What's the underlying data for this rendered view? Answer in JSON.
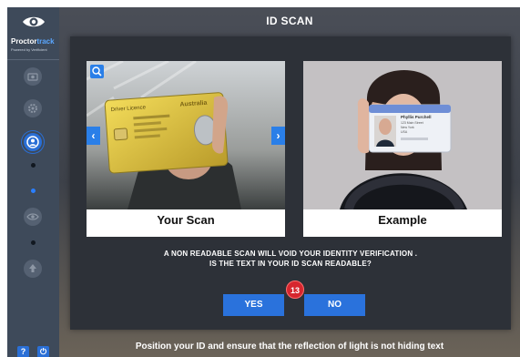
{
  "brand": {
    "name_main": "Proctor",
    "name_accent": "track",
    "tagline": "Powered by Verificient"
  },
  "sidebar": {
    "steps": [
      {
        "icon": "camera-icon"
      },
      {
        "icon": "gear-icon"
      },
      {
        "icon": "id-badge-icon",
        "active": true
      },
      {
        "icon": "eye-icon"
      },
      {
        "icon": "upload-icon"
      }
    ],
    "footer": {
      "help_label": "?",
      "power_label": "⏻"
    }
  },
  "header": {
    "title": "ID SCAN"
  },
  "cards": {
    "scan": {
      "caption": "Your Scan",
      "prev_label": "‹",
      "next_label": "›"
    },
    "example": {
      "caption": "Example"
    }
  },
  "scan_card_text": {
    "license_title": "Driver Licence",
    "state": "Australia"
  },
  "example_card_text": {
    "name": "Phyllis Purchell",
    "line2": "123 Main Street",
    "line3": "New York",
    "line4": "USA"
  },
  "question": {
    "line1": "A NON READABLE SCAN WILL VOID YOUR IDENTITY VERIFICATION .",
    "line2": "IS THE TEXT IN YOUR ID SCAN READABLE?"
  },
  "actions": {
    "yes_label": "YES",
    "no_label": "NO",
    "badge_count": "13"
  },
  "footer": {
    "hint": "Position your ID and ensure that the reflection of light is not hiding text"
  },
  "colors": {
    "accent": "#2a72dc",
    "badge": "#d6262e",
    "sidebar": "#3e4a5a"
  }
}
